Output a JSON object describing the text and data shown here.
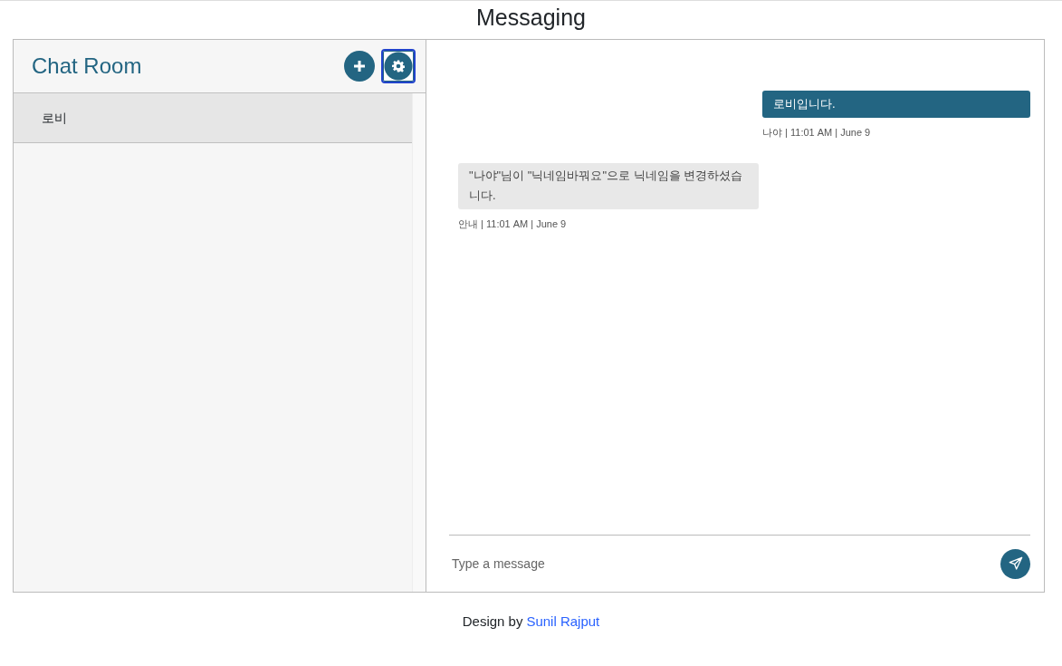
{
  "page_title": "Messaging",
  "sidebar": {
    "title": "Chat Room",
    "buttons": [
      {
        "kind": "add",
        "focused": false
      },
      {
        "kind": "settings",
        "focused": true
      }
    ],
    "rooms": [
      {
        "name": "로비",
        "selected": true
      }
    ]
  },
  "messages": [
    {
      "kind": "sent",
      "text": "로비입니다.",
      "meta": "나야 | 11:01 AM | June 9"
    },
    {
      "kind": "received",
      "text": "\"나야\"님이 \"닉네임바꿔요\"으로 닉네임을 변경하셨습니다.",
      "meta": "안내 | 11:01 AM | June 9"
    }
  ],
  "composer": {
    "placeholder": "Type a message"
  },
  "footer": {
    "text": "Design by",
    "link": "Sunil Rajput"
  }
}
